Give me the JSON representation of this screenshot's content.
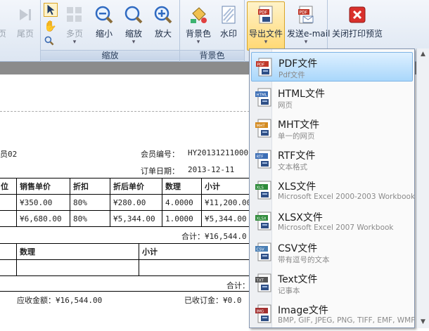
{
  "ribbon": {
    "nav": {
      "prev_label": "页",
      "last_label": "尾页"
    },
    "zoom": {
      "multi_label": "多页",
      "zoom_out_label": "缩小",
      "zoom_label": "缩放",
      "zoom_in_label": "放大",
      "group_label": "缩放"
    },
    "bg": {
      "bgcolor_label": "背景色",
      "watermark_label": "水印",
      "group_label": "背景色"
    },
    "export": {
      "export_label": "导出文件",
      "email_label": "发送e-mail"
    },
    "close": {
      "close_label": "关闭打印预览"
    }
  },
  "doc": {
    "member_suffix": "员02",
    "member_no_label": "会员编号：",
    "member_no": "HY20131211000",
    "order_date_label": "订单日期：",
    "order_date": "2013-12-11",
    "table1": {
      "headers": [
        "位",
        "销售单价",
        "折扣",
        "折后单价",
        "数理",
        "小计"
      ],
      "rows": [
        [
          "",
          "¥350.00",
          "80%",
          "¥280.00",
          "4.0000",
          "¥11,200.00"
        ],
        [
          "",
          "¥6,680.00",
          "80%",
          "¥5,344.00",
          "1.0000",
          "¥5,344.00"
        ]
      ]
    },
    "total1": "合计：¥16,544.0",
    "table2": {
      "headers": [
        "",
        "数理",
        "小计"
      ]
    },
    "total2": "合计：",
    "receivable": "应收金额：¥16,544.00",
    "received": "已收订金：¥0.0"
  },
  "menu": {
    "items": [
      {
        "name": "PDF文件",
        "desc": "Pdf文件",
        "badge": "PDF",
        "color": "#c0392b"
      },
      {
        "name": "HTML文件",
        "desc": "网页",
        "badge": "HTML",
        "color": "#3d6fb6"
      },
      {
        "name": "MHT文件",
        "desc": "单一的网页",
        "badge": "MHT",
        "color": "#d48a1e"
      },
      {
        "name": "RTF文件",
        "desc": "文本格式",
        "badge": "RTF",
        "color": "#3d6fb6"
      },
      {
        "name": "XLS文件",
        "desc": "Microsoft Excel 2000-2003 Workbook",
        "badge": "XLS",
        "color": "#2e8b3a"
      },
      {
        "name": "XLSX文件",
        "desc": "Microsoft Excel 2007 Workbook",
        "badge": "XLSX",
        "color": "#2e8b3a"
      },
      {
        "name": "CSV文件",
        "desc": "带有逗号的文本",
        "badge": "CSV",
        "color": "#4a7fb5"
      },
      {
        "name": "Text文件",
        "desc": "记事本",
        "badge": "TXT",
        "color": "#555555"
      },
      {
        "name": "Image文件",
        "desc": "BMP, GIF, JPEG, PNG, TIFF, EMF, WMF",
        "badge": "IMG",
        "color": "#a33030"
      }
    ]
  },
  "colors": {
    "accent_hover": "#a9d7fb",
    "active_button": "#ffd873",
    "close_red": "#d9302c"
  }
}
